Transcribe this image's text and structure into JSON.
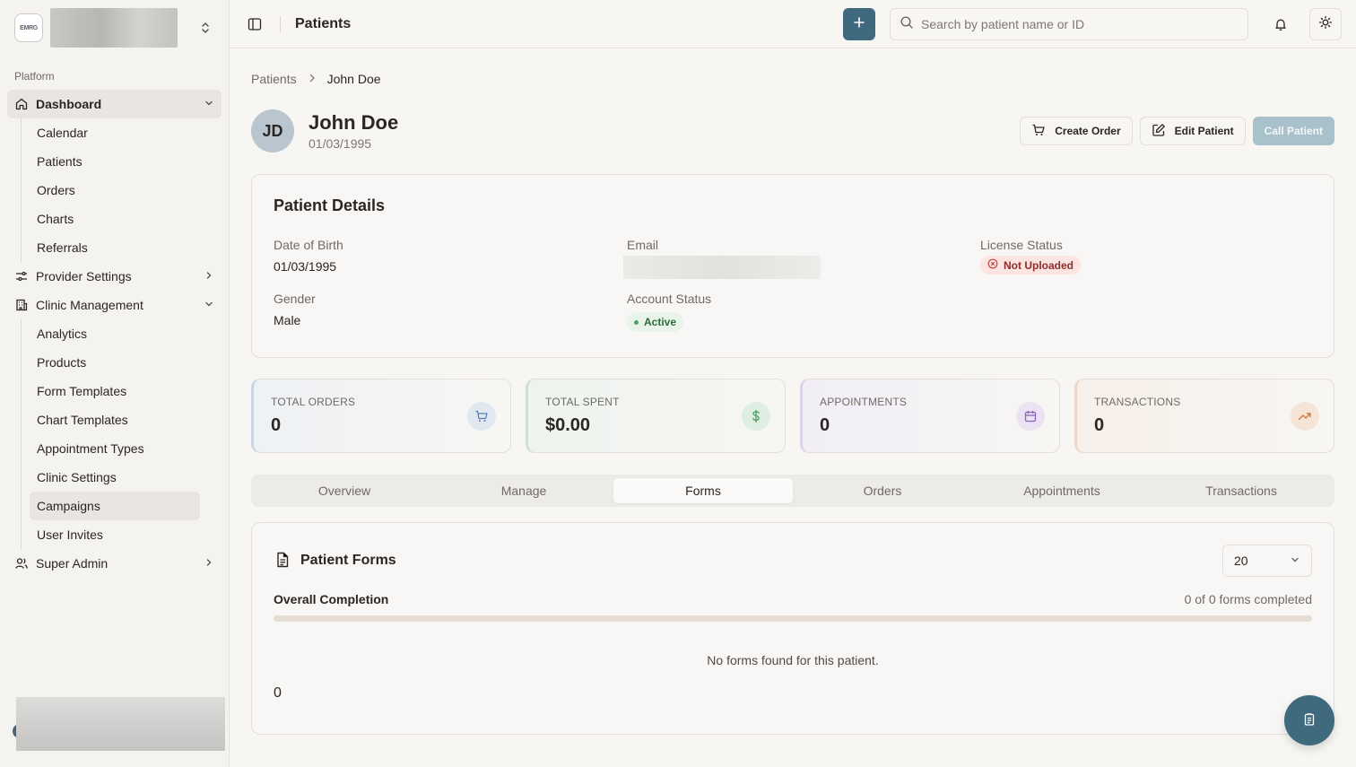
{
  "brand": {
    "logo_text": "EMRG"
  },
  "sidebar": {
    "group_label": "Platform",
    "dashboard": {
      "label": "Dashboard",
      "items": [
        "Calendar",
        "Patients",
        "Orders",
        "Charts",
        "Referrals"
      ]
    },
    "provider_settings": {
      "label": "Provider Settings"
    },
    "clinic_management": {
      "label": "Clinic Management",
      "items": [
        "Analytics",
        "Products",
        "Form Templates",
        "Chart Templates",
        "Appointment Types",
        "Clinic Settings",
        "Campaigns",
        "User Invites"
      ]
    },
    "super_admin": {
      "label": "Super Admin"
    }
  },
  "topbar": {
    "title": "Patients",
    "search_placeholder": "Search by patient name or ID"
  },
  "breadcrumb": {
    "parent": "Patients",
    "current": "John Doe"
  },
  "patient": {
    "initials": "JD",
    "name": "John Doe",
    "dob": "01/03/1995"
  },
  "actions": {
    "create_order": "Create Order",
    "edit_patient": "Edit Patient",
    "call_patient": "Call Patient"
  },
  "details": {
    "title": "Patient Details",
    "dob_label": "Date of Birth",
    "dob_value": "01/03/1995",
    "email_label": "Email",
    "license_label": "License Status",
    "license_value": "Not Uploaded",
    "gender_label": "Gender",
    "gender_value": "Male",
    "account_label": "Account Status",
    "account_value": "Active"
  },
  "stats": [
    {
      "label": "TOTAL ORDERS",
      "value": "0",
      "icon": "cart-icon",
      "color": "#5b7fb5"
    },
    {
      "label": "TOTAL SPENT",
      "value": "$0.00",
      "icon": "dollar-icon",
      "color": "#4f9a5f"
    },
    {
      "label": "APPOINTMENTS",
      "value": "0",
      "icon": "calendar-icon",
      "color": "#8a64b8"
    },
    {
      "label": "TRANSACTIONS",
      "value": "0",
      "icon": "trending-up-icon",
      "color": "#d2793f"
    }
  ],
  "tabs": [
    "Overview",
    "Manage",
    "Forms",
    "Orders",
    "Appointments",
    "Transactions"
  ],
  "active_tab": "Forms",
  "forms": {
    "title": "Patient Forms",
    "page_size": "20",
    "completion_label": "Overall Completion",
    "completion_count": "0 of 0 forms completed",
    "completion_fraction": 0,
    "empty_message": "No forms found for this patient.",
    "footer_value": "0"
  },
  "colors": {
    "accent": "#3f6a7e",
    "accent_light": "#a9c1cb"
  }
}
